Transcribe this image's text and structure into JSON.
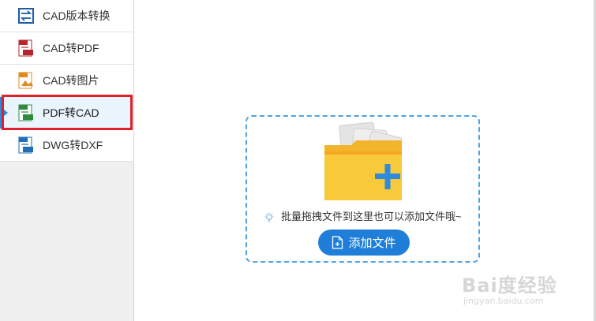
{
  "sidebar": {
    "items": [
      {
        "label": "CAD版本转换",
        "icon": "cad-version-convert-icon",
        "active": false
      },
      {
        "label": "CAD转PDF",
        "icon": "cad-to-pdf-icon",
        "active": false
      },
      {
        "label": "CAD转图片",
        "icon": "cad-to-image-icon",
        "active": false
      },
      {
        "label": "PDF转CAD",
        "icon": "pdf-to-cad-icon",
        "active": true
      },
      {
        "label": "DWG转DXF",
        "icon": "dwg-to-dxf-icon",
        "active": false
      }
    ]
  },
  "dropzone": {
    "hint": "批量拖拽文件到这里也可以添加文件哦~",
    "add_button_label": "添加文件",
    "icons": [
      "folder-add-icon",
      "lightbulb-icon",
      "file-add-icon"
    ]
  },
  "watermark": {
    "brand": "Bai度经验",
    "url": "jingyan.baidu.com"
  },
  "colors": {
    "accent": "#1f7fd8",
    "highlight_border": "#e0202a",
    "dashed_border": "#4ea3e6",
    "folder": "#f6c334"
  }
}
